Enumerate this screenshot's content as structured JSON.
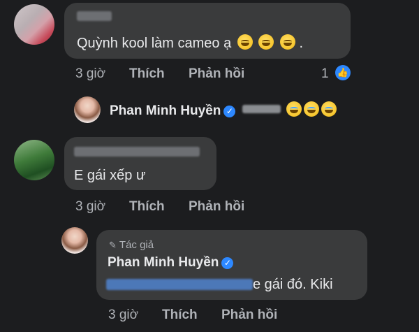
{
  "colors": {
    "background": "#1c1d1f",
    "bubble": "#3a3b3c",
    "text": "#e9eaec",
    "meta": "#b0b3b8",
    "accent": "#2d88ff"
  },
  "comment1": {
    "text": "Quỳnh kool làm cameo ạ",
    "trailing": ".",
    "emojis": [
      "grinning-face-emoji",
      "grinning-face-emoji",
      "grinning-face-emoji"
    ],
    "time": "3 giờ",
    "like_action": "Thích",
    "reply_action": "Phản hồi",
    "reaction_count": "1",
    "reaction_icon": "thumbs-up-icon"
  },
  "reply_preview": {
    "author": "Phan Minh Huyền",
    "emojis": [
      "tears-of-joy-emoji",
      "tears-of-joy-emoji",
      "tears-of-joy-emoji"
    ]
  },
  "comment2": {
    "text": "E gái xếp ư",
    "time": "3 giờ",
    "like_action": "Thích",
    "reply_action": "Phản hồi"
  },
  "reply": {
    "author_badge": "Tác giả",
    "author": "Phan Minh Huyền",
    "text": "e gái đó. Kiki",
    "time": "3 giờ",
    "like_action": "Thích",
    "reply_action": "Phản hồi"
  }
}
